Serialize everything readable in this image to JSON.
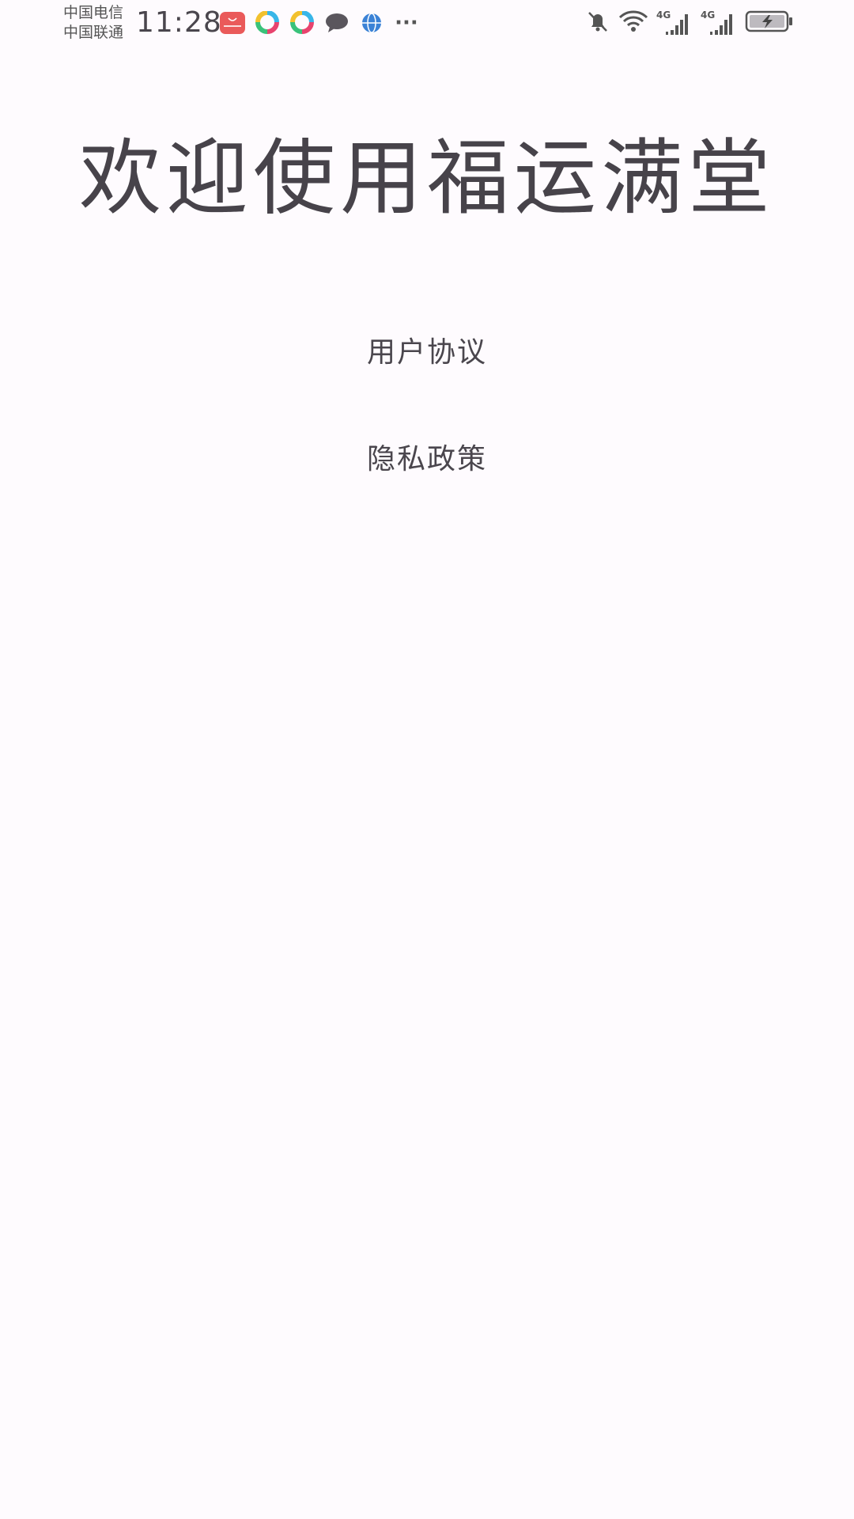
{
  "status_bar": {
    "carrier_1": "中国电信",
    "carrier_2": "中国联通",
    "time": "11:28",
    "notification_icons": [
      "huawei-appgallery-icon",
      "colorful-app-icon",
      "colorful-app-icon",
      "message-bubble-icon",
      "browser-globe-icon",
      "more-dots-icon"
    ],
    "more_label": "···",
    "sim1_network": "4G",
    "sim2_network": "4G",
    "system_icons": [
      "bell-muted-icon",
      "wifi-icon",
      "signal-4g-icon",
      "signal-4g-icon",
      "battery-charging-icon"
    ]
  },
  "main": {
    "title": "欢迎使用福运满堂",
    "user_agreement": "用户协议",
    "privacy_policy": "隐私政策"
  },
  "colors": {
    "background": "#fefbfe",
    "text": "#47434a",
    "appgallery_red": "#ea5a5a",
    "browser_blue": "#3b82d6"
  }
}
